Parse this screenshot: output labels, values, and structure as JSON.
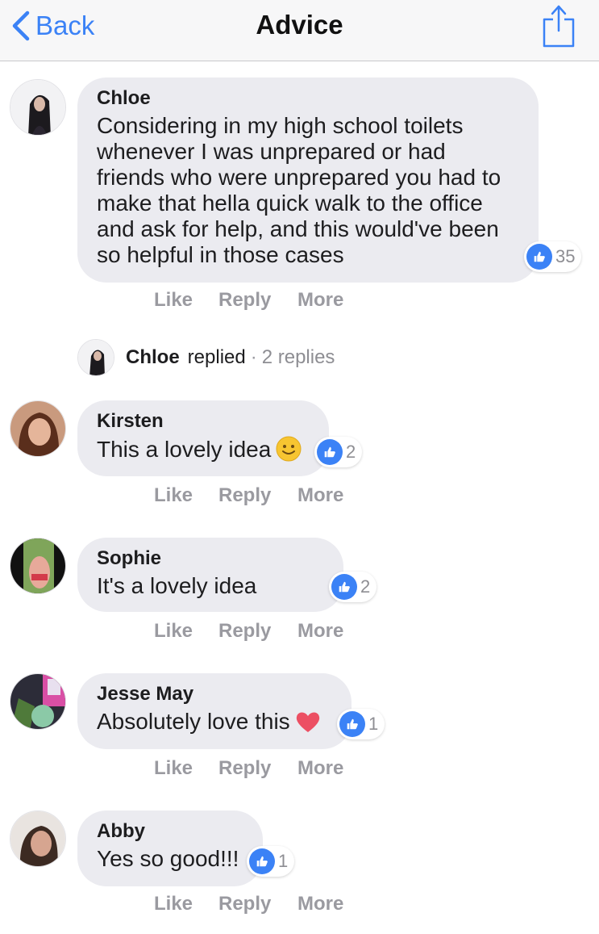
{
  "header": {
    "back_label": "Back",
    "title": "Advice",
    "icons": {
      "back": "chevron-left-icon",
      "share": "share-icon"
    },
    "accent_color": "#3b82f6"
  },
  "actions": {
    "like": "Like",
    "reply": "Reply",
    "more": "More"
  },
  "comments": [
    {
      "author": "Chloe",
      "text": "Considering in my high school toilets whenever I was unprepared or had friends who were unprepared you had to make that hella quick walk to the office and ask for help, and this would've been so helpful in those cases",
      "likes": "35"
    },
    {
      "author": "Kirsten",
      "text": "This a lovely idea",
      "emoji": "smile-emoji",
      "likes": "2"
    },
    {
      "author": "Sophie",
      "text": "It's a lovely idea",
      "likes": "2"
    },
    {
      "author": "Jesse May",
      "text": "Absolutely love this",
      "emoji": "heart-emoji",
      "likes": "1"
    },
    {
      "author": "Abby",
      "text": "Yes so good!!!",
      "likes": "1"
    }
  ],
  "replied": {
    "name": "Chloe",
    "word": "replied",
    "separator": "·",
    "count": "2 replies"
  }
}
